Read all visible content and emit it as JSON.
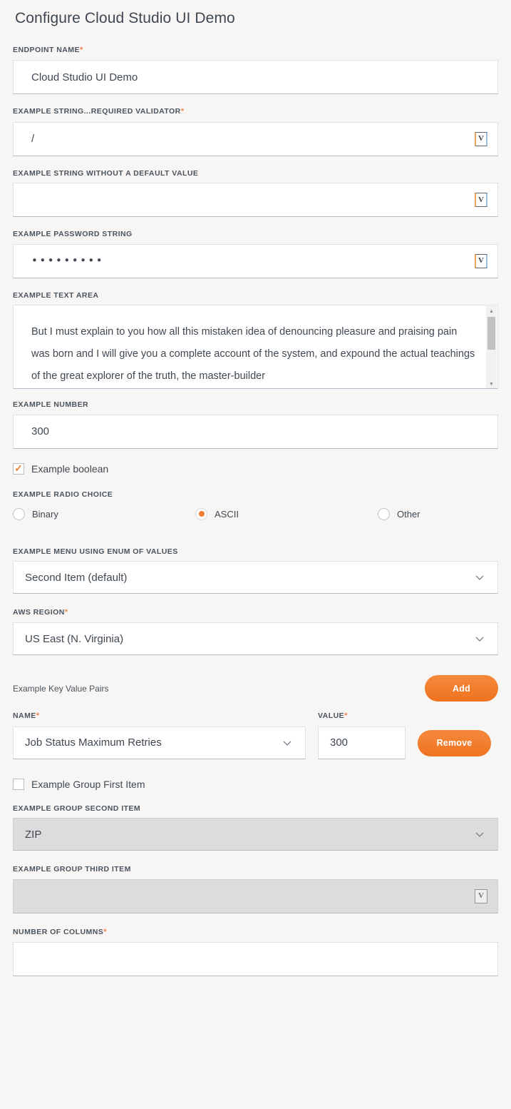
{
  "page": {
    "title": "Configure Cloud Studio UI Demo",
    "background": "#f7f6f5",
    "accent": "#f07d33",
    "required_marker": "*"
  },
  "fields": {
    "endpoint_name": {
      "label": "ENDPOINT NAME",
      "required": true,
      "value": "Cloud Studio UI Demo",
      "type": "text"
    },
    "example_string_required": {
      "label": "EXAMPLE STRING...REQUIRED VALIDATOR",
      "required": true,
      "value": "/",
      "type": "text-with-variable",
      "variable_button": "V"
    },
    "example_string_no_default": {
      "label": "EXAMPLE STRING WITHOUT A DEFAULT VALUE",
      "required": false,
      "value": "",
      "type": "text-with-variable",
      "variable_button": "V"
    },
    "example_password": {
      "label": "EXAMPLE PASSWORD STRING",
      "required": false,
      "value": "•••••••••",
      "masked_length": 9,
      "type": "password-with-variable",
      "variable_button": "V"
    },
    "example_text_area": {
      "label": "EXAMPLE TEXT AREA",
      "required": false,
      "value": "But I must explain to you how all this mistaken idea of denouncing pleasure and praising pain was born and I will give you a complete account of the system, and expound the actual teachings of the great explorer of the truth, the master-builder",
      "type": "textarea",
      "scrollable": true
    },
    "example_number": {
      "label": "EXAMPLE NUMBER",
      "required": false,
      "value": "300",
      "type": "number"
    },
    "example_boolean": {
      "label": "Example boolean",
      "checked": true,
      "type": "checkbox"
    },
    "example_radio_choice": {
      "label": "EXAMPLE RADIO CHOICE",
      "type": "radio-group",
      "selected": "ASCII",
      "options": [
        {
          "label": "Binary",
          "selected": false
        },
        {
          "label": "ASCII",
          "selected": true
        },
        {
          "label": "Other",
          "selected": false
        }
      ]
    },
    "example_menu_enum": {
      "label": "EXAMPLE MENU USING ENUM OF VALUES",
      "required": false,
      "value": "Second Item (default)",
      "type": "select"
    },
    "aws_region": {
      "label": "AWS REGION",
      "required": true,
      "value": "US East (N. Virginia)",
      "type": "select"
    },
    "key_value_pairs": {
      "label": "Example Key Value Pairs",
      "add_button": "Add",
      "name_label": "NAME",
      "name_required": true,
      "value_label": "VALUE",
      "value_required": true,
      "remove_button": "Remove",
      "rows": [
        {
          "name": "Job Status Maximum Retries",
          "value": "300"
        }
      ]
    },
    "group_first_item": {
      "label": "Example Group First Item",
      "checked": false,
      "type": "checkbox"
    },
    "group_second_item": {
      "label": "EXAMPLE GROUP SECOND ITEM",
      "required": false,
      "value": "ZIP",
      "type": "select",
      "disabled": true
    },
    "group_third_item": {
      "label": "EXAMPLE GROUP THIRD ITEM",
      "required": false,
      "value": "",
      "type": "text-with-variable",
      "variable_button": "V",
      "disabled": true
    },
    "number_of_columns": {
      "label": "NUMBER OF COLUMNS",
      "required": true,
      "value": "",
      "type": "text"
    }
  }
}
